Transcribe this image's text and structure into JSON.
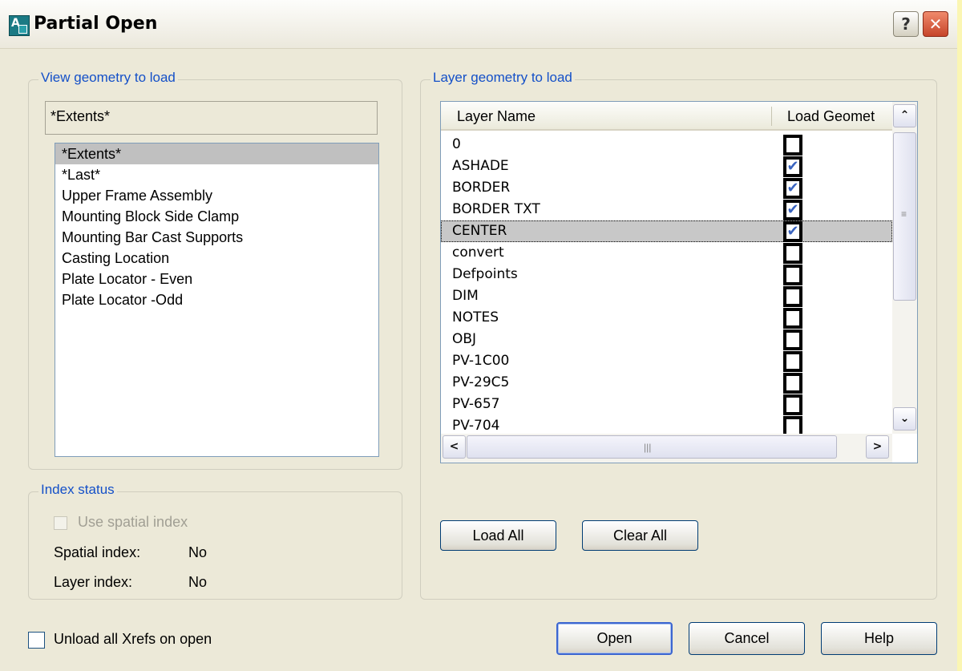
{
  "window": {
    "title": "Partial Open",
    "app_icon": "autocad-app-icon",
    "help_glyph": "?",
    "close_glyph": "✕"
  },
  "view_geometry": {
    "legend": "View geometry to load",
    "current": "*Extents*",
    "items": [
      "*Extents*",
      "*Last*",
      "Upper Frame Assembly",
      "Mounting Block Side Clamp",
      "Mounting Bar Cast Supports",
      "Casting Location",
      "Plate Locator - Even",
      "Plate Locator -Odd"
    ],
    "selected_index": 0
  },
  "index_status": {
    "legend": "Index status",
    "use_spatial_index_label": "Use spatial index",
    "spatial_index_label": "Spatial index:",
    "spatial_index_value": "No",
    "layer_index_label": "Layer index:",
    "layer_index_value": "No"
  },
  "layer_geometry": {
    "legend": "Layer geometry to load",
    "columns": [
      "Layer Name",
      "Load Geomet"
    ],
    "rows": [
      {
        "name": "0",
        "checked": false
      },
      {
        "name": "ASHADE",
        "checked": true
      },
      {
        "name": "BORDER",
        "checked": true
      },
      {
        "name": "BORDER TXT",
        "checked": true
      },
      {
        "name": "CENTER",
        "checked": true
      },
      {
        "name": "convert",
        "checked": false
      },
      {
        "name": "Defpoints",
        "checked": false
      },
      {
        "name": "DIM",
        "checked": false
      },
      {
        "name": "NOTES",
        "checked": false
      },
      {
        "name": "OBJ",
        "checked": false
      },
      {
        "name": "PV-1C00",
        "checked": false
      },
      {
        "name": "PV-29C5",
        "checked": false
      },
      {
        "name": "PV-657",
        "checked": false
      },
      {
        "name": "PV-704",
        "checked": false
      }
    ],
    "selected_index": 4,
    "check_glyph": "✔",
    "load_all_label": "Load All",
    "clear_all_label": "Clear All"
  },
  "scroll": {
    "up": "⌃",
    "down": "⌄",
    "left": "<",
    "right": ">",
    "grip_v": "≡",
    "grip_h": "|||"
  },
  "footer": {
    "unload_xrefs_label": "Unload all Xrefs on open",
    "open_label": "Open",
    "cancel_label": "Cancel",
    "help_label": "Help"
  }
}
